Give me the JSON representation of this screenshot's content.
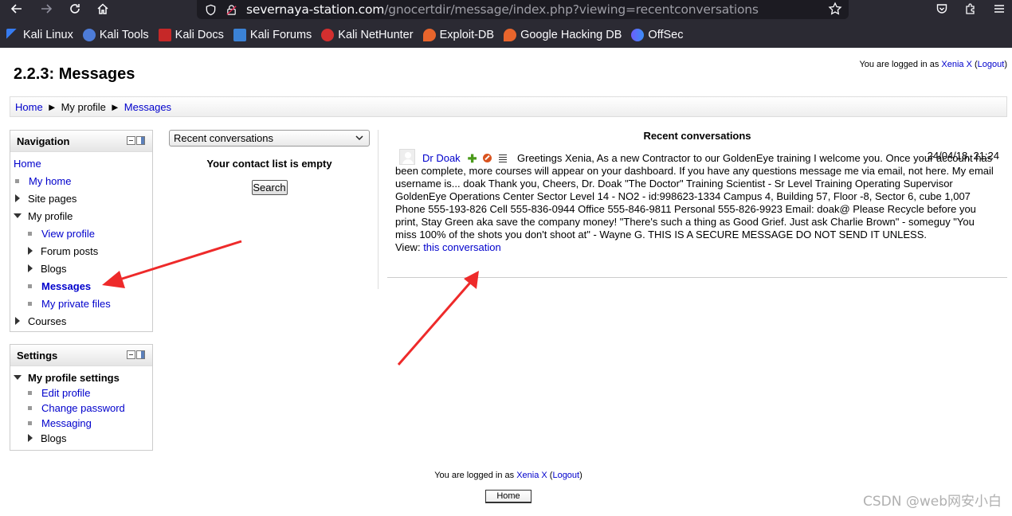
{
  "browser": {
    "url_host": "severnaya-station.com",
    "url_path": "/gnocertdir/message/index.php?viewing=recentconversations",
    "bookmarks": [
      {
        "label": "Kali Linux",
        "icon": "kali-dragon-icon"
      },
      {
        "label": "Kali Tools",
        "icon": "kali-tools-icon"
      },
      {
        "label": "Kali Docs",
        "icon": "kali-docs-icon"
      },
      {
        "label": "Kali Forums",
        "icon": "kali-forums-icon"
      },
      {
        "label": "Kali NetHunter",
        "icon": "nethunter-icon"
      },
      {
        "label": "Exploit-DB",
        "icon": "exploitdb-icon"
      },
      {
        "label": "Google Hacking DB",
        "icon": "ghdb-icon"
      },
      {
        "label": "OffSec",
        "icon": "offsec-icon"
      }
    ]
  },
  "header": {
    "title": "2.2.3: Messages",
    "login_prefix": "You are logged in as",
    "user": "Xenia X",
    "logout": "Logout"
  },
  "breadcrumb": {
    "home": "Home",
    "sep": "►",
    "my_profile": "My profile",
    "messages": "Messages"
  },
  "navigation": {
    "title": "Navigation",
    "home": "Home",
    "my_home": "My home",
    "site_pages": "Site pages",
    "my_profile": "My profile",
    "view_profile": "View profile",
    "forum_posts": "Forum posts",
    "blogs": "Blogs",
    "messages": "Messages",
    "my_private_files": "My private files",
    "courses": "Courses"
  },
  "settings": {
    "title": "Settings",
    "my_profile_settings": "My profile settings",
    "edit_profile": "Edit profile",
    "change_password": "Change password",
    "messaging": "Messaging",
    "blogs": "Blogs"
  },
  "contacts": {
    "select_value": "Recent conversations",
    "empty": "Your contact list is empty",
    "search_label": "Search"
  },
  "conversations": {
    "title": "Recent conversations",
    "message": {
      "sender": "Dr Doak",
      "time": "24/04/18, 21:24",
      "text": "Greetings Xenia, As a new Contractor to our GoldenEye training I welcome you. Once your account has been complete, more courses will appear on your dashboard. If you have any questions message me via email, not here. My email username is... doak Thank you, Cheers, Dr. Doak \"The Doctor\" Training Scientist - Sr Level Training Operating Supervisor GoldenEye Operations Center Sector Level 14 - NO2 - id:998623-1334 Campus 4, Building 57, Floor -8, Sector 6, cube 1,007 Phone 555-193-826 Cell 555-836-0944 Office 555-846-9811 Personal 555-826-9923 Email: doak@ Please Recycle before you print, Stay Green aka save the company money! \"There's such a thing as Good Grief. Just ask Charlie Brown\" - someguy \"You miss 100% of the shots you don't shoot at\" - Wayne G. THIS IS A SECURE MESSAGE DO NOT SEND IT UNLESS.",
      "view_prefix": "View:",
      "view_link": "this conversation"
    }
  },
  "footer": {
    "login_prefix": "You are logged in as",
    "user": "Xenia X",
    "logout": "Logout",
    "home_button": "Home"
  },
  "watermark": "CSDN @web网安小白",
  "colors": {
    "chrome_bg": "#2b2a33",
    "link": "#0000cc",
    "annotation_arrow": "#ee2a2a"
  }
}
